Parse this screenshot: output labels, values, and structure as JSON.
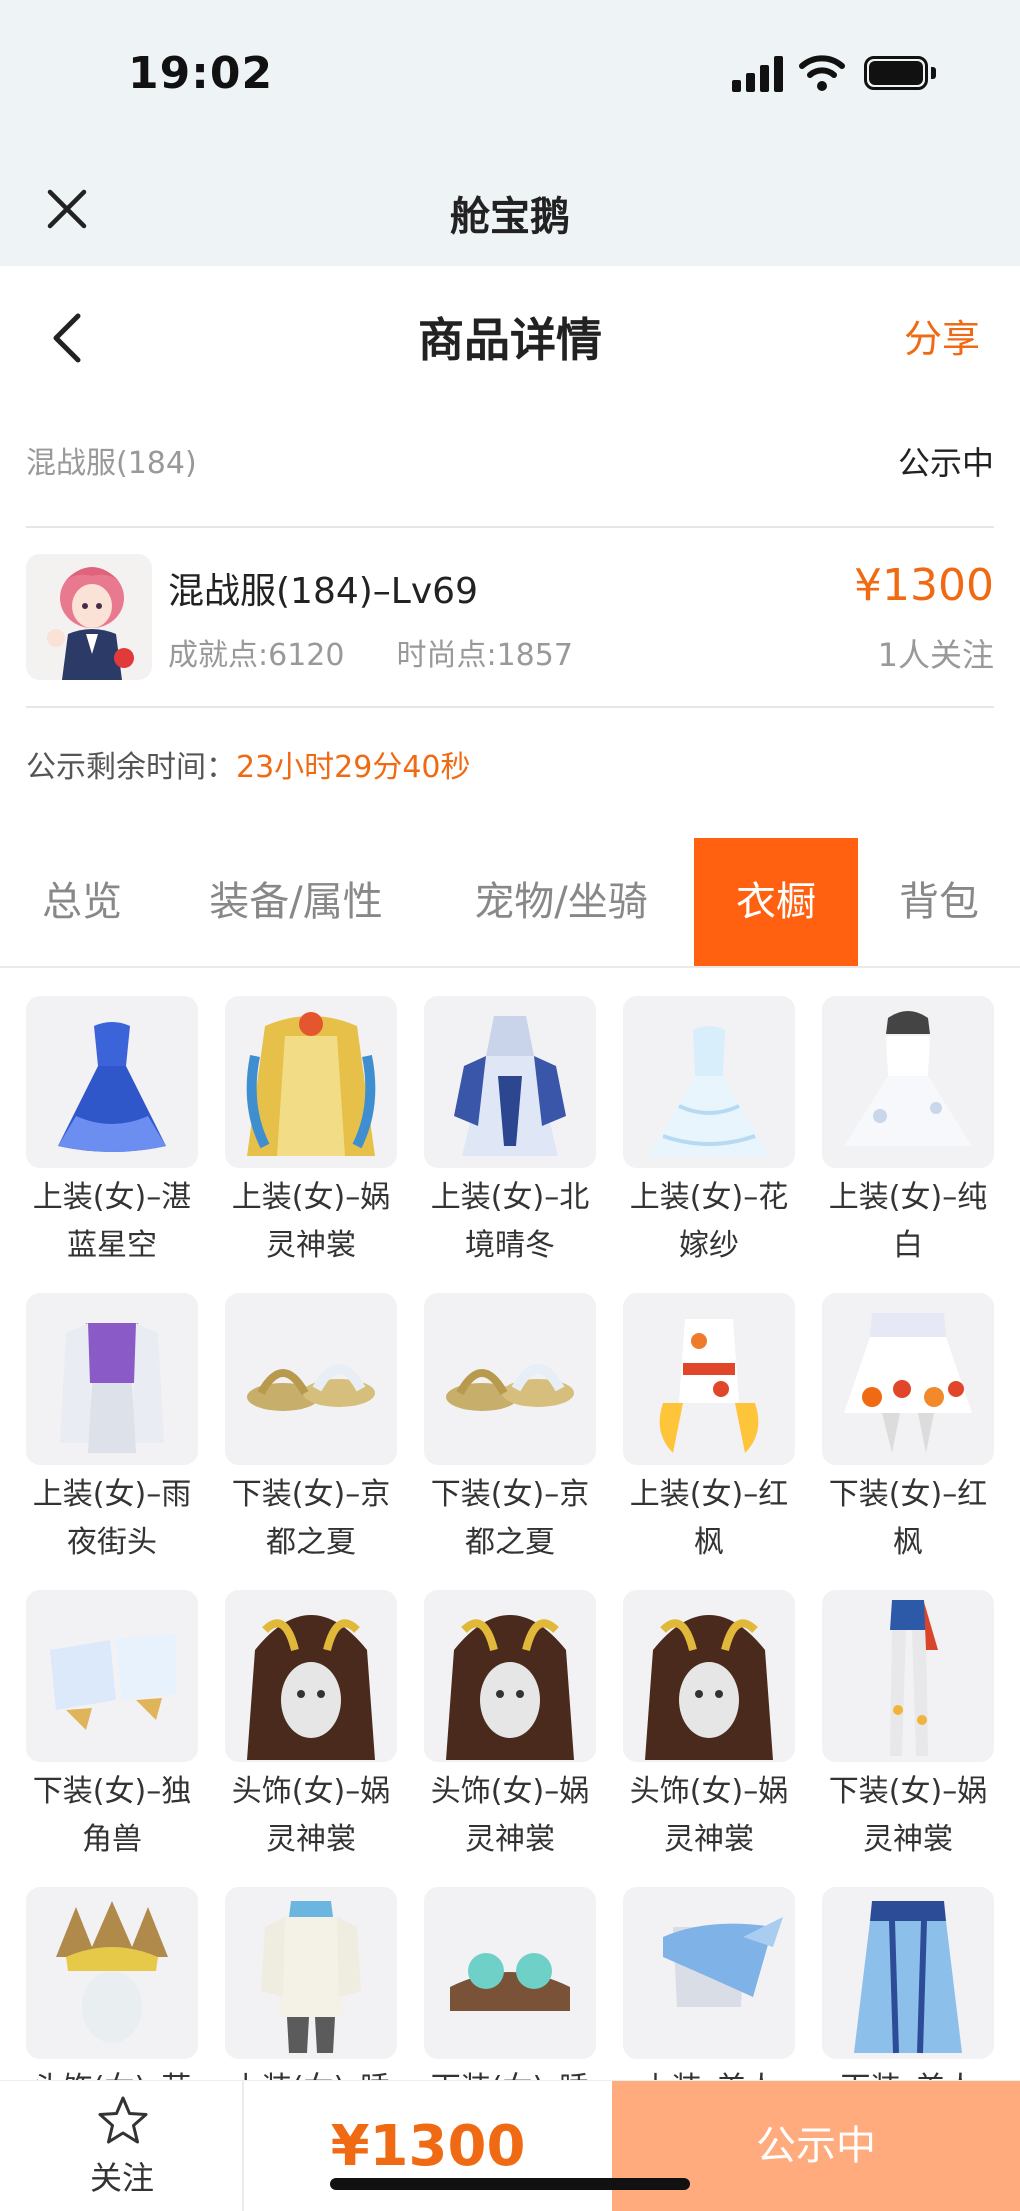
{
  "status_bar": {
    "time": "19:02"
  },
  "app_header": {
    "title": "舱宝鹅"
  },
  "nav": {
    "title": "商品详情",
    "share_label": "分享"
  },
  "listing": {
    "server_name": "混战服(184)",
    "status": "公示中",
    "product_name": "混战服(184)–Lv69",
    "achievement_label": "成就点:6120",
    "fashion_label": "时尚点:1857",
    "price": "¥1300",
    "followers": "1人关注",
    "timer_label": "公示剩余时间：",
    "timer_value": "23小时29分40秒"
  },
  "tabs": [
    {
      "label": "总览",
      "active": false
    },
    {
      "label": "装备/属性",
      "active": false
    },
    {
      "label": "宠物/坐骑",
      "active": false
    },
    {
      "label": "衣橱",
      "active": true
    },
    {
      "label": "背包",
      "active": false
    }
  ],
  "wardrobe_items": [
    {
      "label": "上装(女)–湛蓝星空",
      "icon": "blue-dress-icon"
    },
    {
      "label": "上装(女)–娲灵神裳",
      "icon": "golden-robe-icon"
    },
    {
      "label": "上装(女)–北境晴冬",
      "icon": "winter-armor-icon"
    },
    {
      "label": "上装(女)–花嫁纱",
      "icon": "wedding-dress-icon"
    },
    {
      "label": "上装(女)–纯白",
      "icon": "white-dress-icon"
    },
    {
      "label": "上装(女)–雨夜街头",
      "icon": "street-outfit-icon"
    },
    {
      "label": "下装(女)–京都之夏",
      "icon": "sandals-icon"
    },
    {
      "label": "下装(女)–京都之夏",
      "icon": "sandals-icon"
    },
    {
      "label": "上装(女)–红枫",
      "icon": "maple-kimono-icon"
    },
    {
      "label": "下装(女)–红枫",
      "icon": "maple-skirt-icon"
    },
    {
      "label": "下装(女)–独角兽",
      "icon": "unicorn-boots-icon"
    },
    {
      "label": "头饰(女)–娲灵神裳",
      "icon": "headdress-icon"
    },
    {
      "label": "头饰(女)–娲灵神裳",
      "icon": "headdress-icon"
    },
    {
      "label": "头饰(女)–娲灵神裳",
      "icon": "headdress-icon"
    },
    {
      "label": "下装(女)–娲灵神裳",
      "icon": "legs-outfit-icon"
    },
    {
      "label": "头饰(女)–萌",
      "icon": "feather-crown-icon"
    },
    {
      "label": "上装(女)–睡",
      "icon": "pajama-top-icon"
    },
    {
      "label": "下装(女)–睡",
      "icon": "slippers-icon"
    },
    {
      "label": "上装–美人",
      "icon": "shawl-top-icon"
    },
    {
      "label": "下装–美人",
      "icon": "long-skirt-icon"
    }
  ],
  "bottom_bar": {
    "follow_label": "关注",
    "price": "¥1300",
    "action_label": "公示中"
  },
  "colors": {
    "accent": "#f06a13",
    "tab_active": "#ff6111",
    "action_button": "#ffab7e"
  }
}
